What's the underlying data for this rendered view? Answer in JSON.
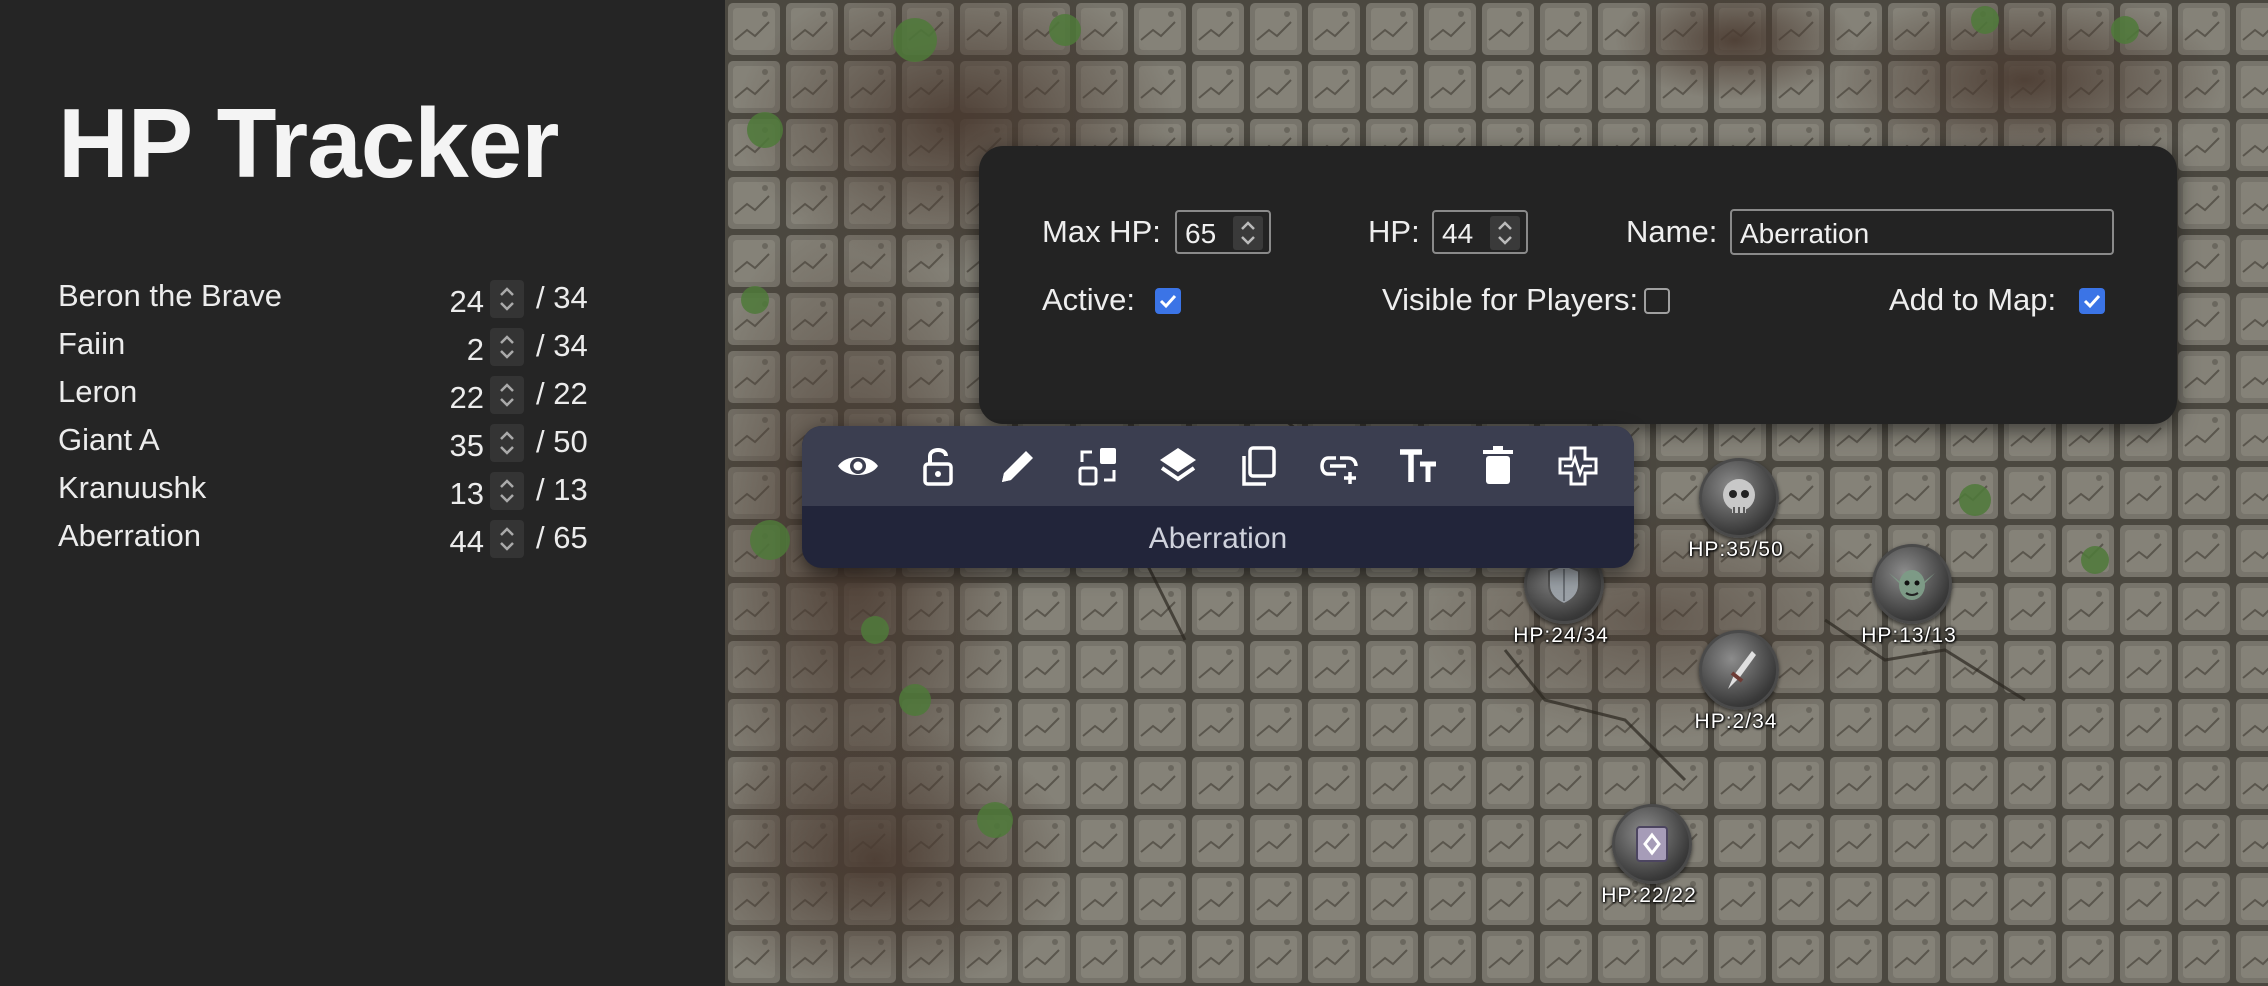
{
  "app": {
    "title": "HP Tracker"
  },
  "tracker": [
    {
      "name": "Beron the Brave",
      "hp": "24",
      "max": "/ 34"
    },
    {
      "name": "Faiin",
      "hp": "2",
      "max": "/ 34"
    },
    {
      "name": "Leron",
      "hp": "22",
      "max": "/ 22"
    },
    {
      "name": "Giant A",
      "hp": "35",
      "max": "/ 50"
    },
    {
      "name": "Kranuushk",
      "hp": "13",
      "max": "/ 13"
    },
    {
      "name": "Aberration",
      "hp": "44",
      "max": "/ 65"
    }
  ],
  "panel": {
    "max_hp_label": "Max HP:",
    "max_hp_value": "65",
    "hp_label": "HP:",
    "hp_value": "44",
    "name_label": "Name:",
    "name_value": "Aberration",
    "active_label": "Active:",
    "active_checked": true,
    "visible_label": "Visible for Players:",
    "visible_checked": false,
    "add_label": "Add to Map:",
    "add_checked": true
  },
  "toolbar": {
    "tools": [
      "eye-icon",
      "unlock-icon",
      "pencil-icon",
      "swap-icon",
      "layers-icon",
      "copy-icon",
      "link-add-icon",
      "text-icon",
      "trash-icon",
      "hp-tracker-icon"
    ],
    "selected_name": "Aberration"
  },
  "tokens": [
    {
      "hp": "HP:35/50",
      "icon": "skull-icon"
    },
    {
      "hp": "HP:24/34",
      "icon": "shield-icon"
    },
    {
      "hp": "HP:13/13",
      "icon": "goblin-icon"
    },
    {
      "hp": "HP:2/34",
      "icon": "blade-icon"
    },
    {
      "hp": "HP:22/22",
      "icon": "book-icon"
    }
  ],
  "colors": {
    "sidebar": "#252525",
    "panel": "#232323",
    "toolbar": "#3b3e50",
    "toolbar_footer": "#22253a",
    "checkbox": "#3b74e6"
  }
}
